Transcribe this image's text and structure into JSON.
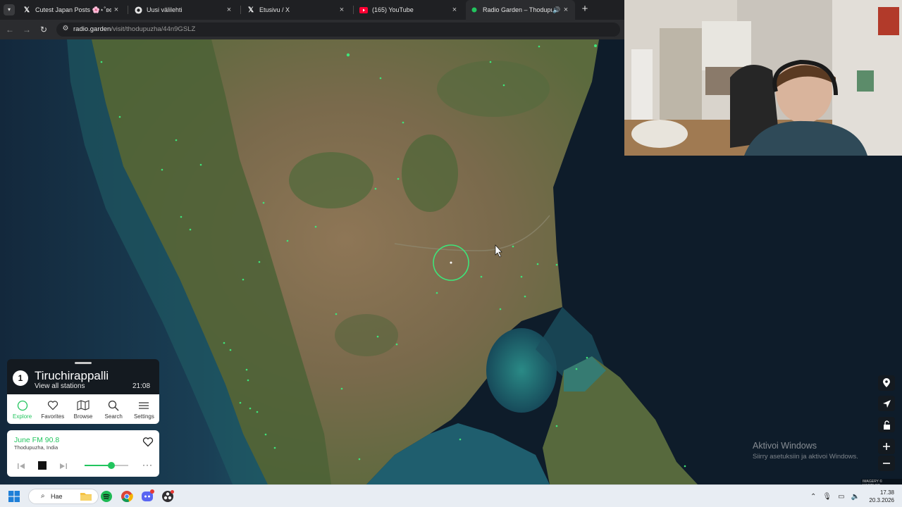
{
  "browser": {
    "tabs": [
      {
        "title": "Cutest Japan Posts 🌸⋆˚ʚɞ ¨c...",
        "icon": "x-logo-icon",
        "active": false
      },
      {
        "title": "Uusi välilehti",
        "icon": "chrome-icon",
        "active": false
      },
      {
        "title": "Etusivu / X",
        "icon": "x-logo-icon",
        "active": false
      },
      {
        "title": "(165) YouTube",
        "icon": "youtube-icon",
        "active": false
      },
      {
        "title": "Radio Garden – Thodupuzh...",
        "icon": "radio-garden-icon",
        "active": true,
        "audio": true
      }
    ],
    "url_host": "radio.garden",
    "url_path": "/visit/thodupuzha/44n9GSLZ"
  },
  "radio": {
    "place_count": "1",
    "place_name": "Tiruchirappalli",
    "view_all": "View all stations",
    "local_time": "21:08",
    "nav": [
      {
        "label": "Explore",
        "icon": "explore-icon",
        "active": true
      },
      {
        "label": "Favorites",
        "icon": "heart-icon",
        "active": false
      },
      {
        "label": "Browse",
        "icon": "map-icon",
        "active": false
      },
      {
        "label": "Search",
        "icon": "search-icon",
        "active": false
      },
      {
        "label": "Settings",
        "icon": "menu-icon",
        "active": false
      }
    ],
    "player": {
      "station": "June FM 90.8",
      "location": "Thodupuzha, India",
      "volume": 0.62,
      "more": "···"
    },
    "accent": "#22c55e"
  },
  "map_controls": [
    "pin-icon",
    "locate-icon",
    "lock-icon",
    "zoom-in-icon",
    "zoom-out-icon"
  ],
  "watermark": {
    "title": "Aktivoi Windows",
    "subtitle": "Siirry asetuksiin ja aktivoi Windows."
  },
  "attribution": "IMAGERY © MAPTILER",
  "taskbar": {
    "search_label": "Hae",
    "time": "17.38",
    "date": "20.3.2026",
    "apps": [
      "file-explorer-icon",
      "spotify-icon",
      "chrome-icon",
      "discord-icon",
      "obs-icon"
    ],
    "tray_icons": [
      "chevron-up-icon",
      "microphone-icon",
      "display-icon",
      "speaker-icon"
    ]
  }
}
